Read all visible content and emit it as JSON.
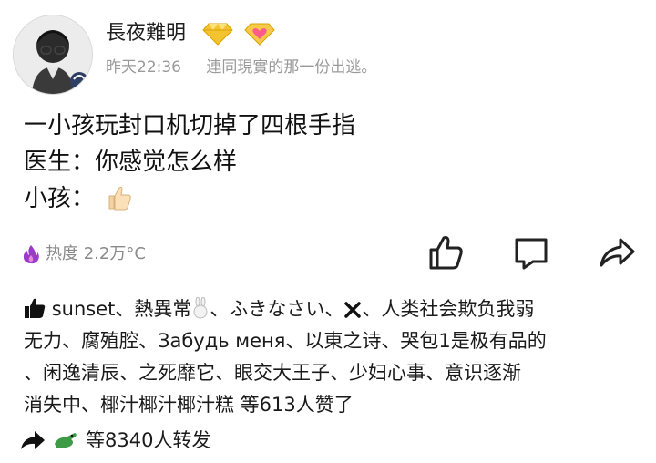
{
  "user": {
    "name": "長夜難明",
    "badges": [
      "gold-diamond-badge",
      "pink-diamond-badge"
    ]
  },
  "meta": {
    "time": "昨天22:36",
    "signature": "連同現實的那一份出逃。"
  },
  "post": {
    "lines": [
      "一小孩玩封口机切掉了四根手指",
      "医生：你感觉怎么样",
      "小孩："
    ],
    "emoji": "thumbs-up-emoji"
  },
  "heat": {
    "label": "热度 2.2万°C",
    "icon": "flame-icon"
  },
  "actions": {
    "like_icon": "thumbs-up-outline-icon",
    "comment_icon": "comment-icon",
    "share_icon": "share-arrow-icon"
  },
  "likes": {
    "rows": [
      [
        "sunset、熱異常",
        "、ふきなさい、",
        "、人类社会欺负我弱"
      ],
      [
        "无力、腐殖腔、Забудь меня、以東之诗、哭包1是极有品的"
      ],
      [
        "、闲逸清辰、之死靡它、眼交大王子、少妇心事、意识逐渐"
      ],
      [
        "消失中、椰汁椰汁椰汁糕 等613人赞了"
      ]
    ]
  },
  "reposts": {
    "label": "等8340人转发"
  },
  "colors": {
    "text": "#1a1a1a",
    "muted": "#9a9a9a",
    "heat_icon": "#9b3bc9"
  }
}
